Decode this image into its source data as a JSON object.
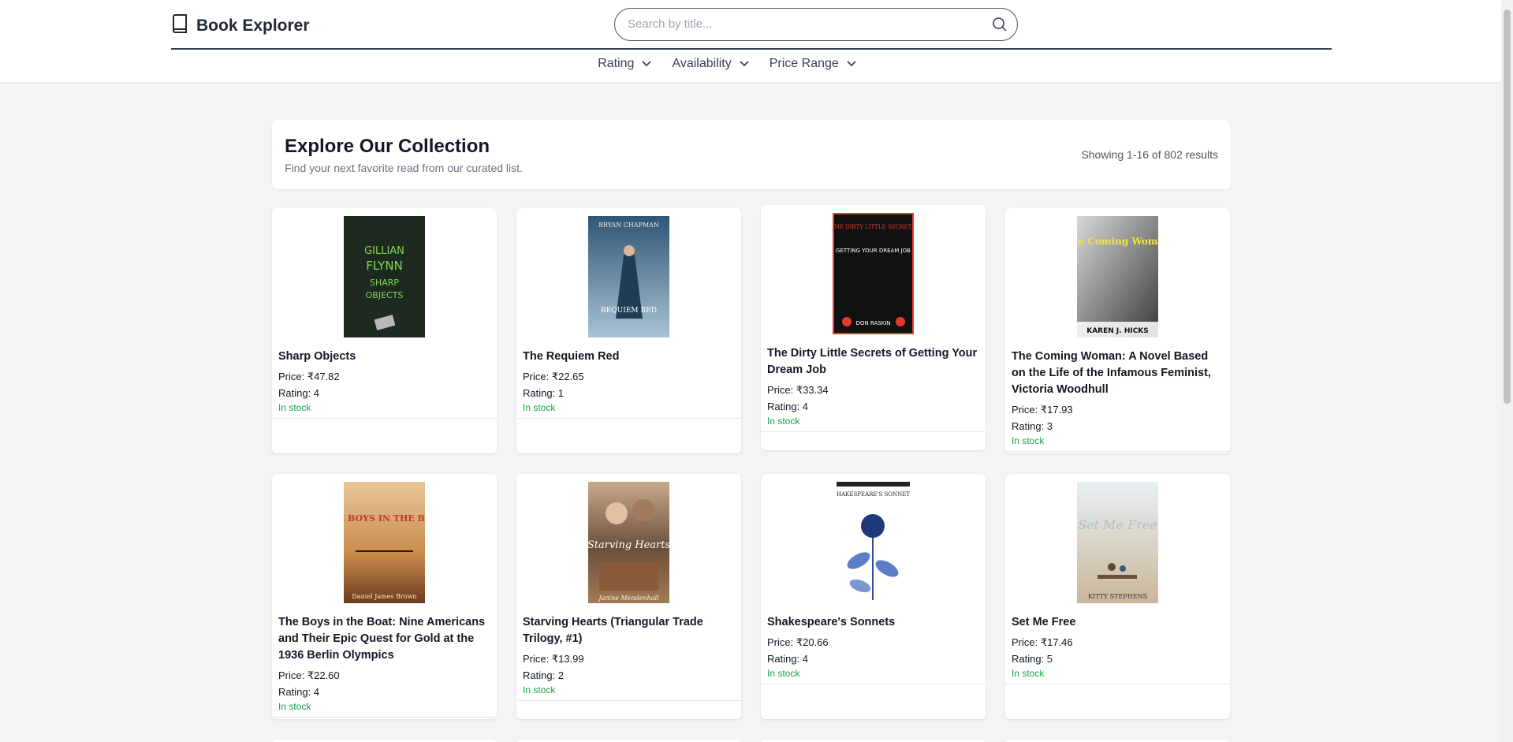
{
  "app": {
    "title": "Book Explorer"
  },
  "search": {
    "placeholder": "Search by title..."
  },
  "filters": [
    "Rating",
    "Availability",
    "Price Range"
  ],
  "header": {
    "title": "Explore Our Collection",
    "subtitle": "Find your next favorite read from our curated list.",
    "results": "Showing 1-16 of 802 results"
  },
  "books": [
    {
      "title": "Sharp Objects",
      "price": "Price: ₹47.82",
      "rating": "Rating: 4",
      "stock": "In stock",
      "cover_colors": [
        "#1f2a20",
        "#7ed957"
      ],
      "cover_text": [
        "GILLIAN",
        "FLYNN",
        "SHARP",
        "OBJECTS"
      ]
    },
    {
      "title": "The Requiem Red",
      "price": "Price: ₹22.65",
      "rating": "Rating: 1",
      "stock": "In stock",
      "cover_colors": [
        "#3e6a8a",
        "#d9e4ec"
      ],
      "cover_text": [
        "BRYAN CHAPMAN",
        "REQUIEM RED"
      ]
    },
    {
      "title": "The Dirty Little Secrets of Getting Your Dream Job",
      "price": "Price: ₹33.34",
      "rating": "Rating: 4",
      "stock": "In stock",
      "cover_colors": [
        "#111111",
        "#e23b2e"
      ],
      "cover_text": [
        "THE DIRTY LITTLE SECRETS",
        "GETTING YOUR DREAM JOB",
        "DON RASKIN"
      ]
    },
    {
      "title": "The Coming Woman: A Novel Based on the Life of the Infamous Feminist, Victoria Woodhull",
      "price": "Price: ₹17.93",
      "rating": "Rating: 3",
      "stock": "In stock",
      "cover_colors": [
        "#8a8a8a",
        "#f2e53b"
      ],
      "cover_text": [
        "The Coming Woman",
        "KAREN J. HICKS"
      ]
    },
    {
      "title": "The Boys in the Boat: Nine Americans and Their Epic Quest for Gold at the 1936 Berlin Olympics",
      "price": "Price: ₹22.60",
      "rating": "Rating: 4",
      "stock": "In stock",
      "cover_colors": [
        "#c98a4a",
        "#c0392b"
      ],
      "cover_text": [
        "THE BOYS IN THE BOAT",
        "Daniel James Brown"
      ]
    },
    {
      "title": "Starving Hearts (Triangular Trade Trilogy, #1)",
      "price": "Price: ₹13.99",
      "rating": "Rating: 2",
      "stock": "In stock",
      "cover_colors": [
        "#6b4f3a",
        "#e9d8c0"
      ],
      "cover_text": [
        "Starving Hearts",
        "Janine Mendenhall"
      ]
    },
    {
      "title": "Shakespeare's Sonnets",
      "price": "Price: ₹20.66",
      "rating": "Rating: 4",
      "stock": "In stock",
      "cover_colors": [
        "#ffffff",
        "#2d4f9a"
      ],
      "cover_text": [
        "SHAKESPEARE'S SONNETS"
      ]
    },
    {
      "title": "Set Me Free",
      "price": "Price: ₹17.46",
      "rating": "Rating: 5",
      "stock": "In stock",
      "cover_colors": [
        "#dfe9ef",
        "#b7c7d2"
      ],
      "cover_text": [
        "Set Me Free",
        "KITTY STEPHENS"
      ]
    }
  ]
}
